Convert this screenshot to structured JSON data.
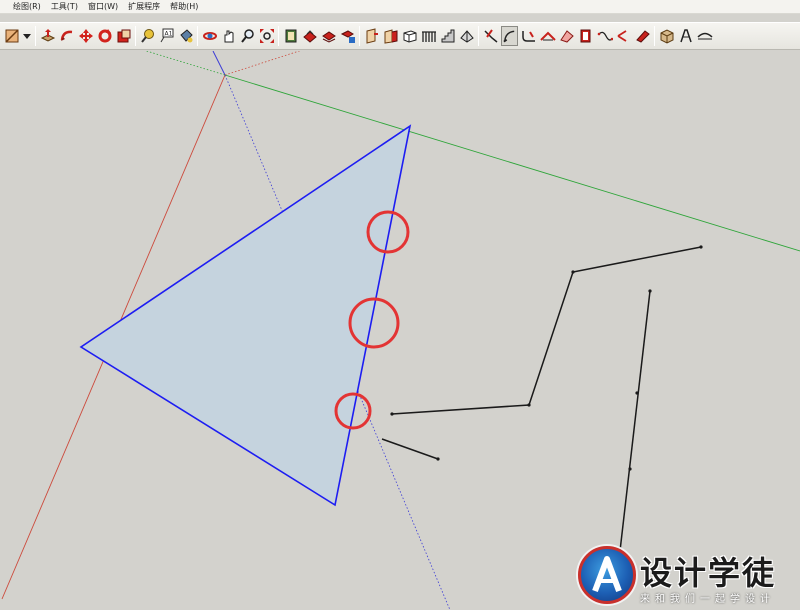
{
  "menubar": {
    "items": [
      "绘图(R)",
      "工具(T)",
      "窗口(W)",
      "扩展程序",
      "帮助(H)"
    ]
  },
  "toolbar": {
    "icons": [
      "line-tool-icon",
      "dropdown-arrow-icon",
      "push-pull-icon",
      "follow-me-icon",
      "move-icon",
      "rotate-icon",
      "scale-icon",
      "tape-measure-icon",
      "dimension-icon",
      "paint-bucket-icon",
      "orbit-icon",
      "pan-icon",
      "zoom-icon",
      "zoom-extents-icon",
      "component-icon",
      "warehouse-icon",
      "get-models-icon",
      "share-model-icon",
      "section-plane-icon",
      "section-display-icon",
      "box-icon",
      "railing-icon",
      "stairs-icon",
      "roof-icon",
      "weld-edges-icon",
      "arc-curve-icon",
      "fillet-icon",
      "chamfer-icon",
      "extrude-icon",
      "path-icon",
      "bezier-icon",
      "eraser-icon",
      "solid-tool-icon",
      "round-corner-icon",
      "tube-icon"
    ],
    "active_tool": "arc-curve-icon"
  },
  "colors": {
    "background": "#d3d2cd",
    "face_fill": "#c5d3de",
    "face_edge": "#1d1df2",
    "red_axis": "#cc4a3c",
    "green_axis": "#2fa53a",
    "blue_axis": "#3b3bd6",
    "highlight_circle": "#e33434",
    "edge_line": "#1a1a1a"
  },
  "watermark": {
    "title": "设计学徒",
    "subtitle": "来和我们一起学设计"
  }
}
